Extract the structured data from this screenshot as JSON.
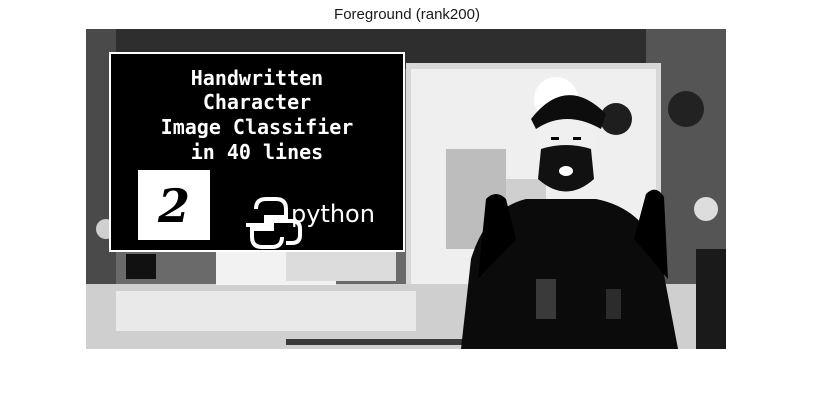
{
  "figure": {
    "title": "Foreground (rank200)"
  },
  "slide": {
    "lines": [
      "Handwritten",
      "Character",
      "Image Classifier",
      "in 40 lines"
    ],
    "digit": "2",
    "logo_word": "python",
    "logo_icon": "python-logo-icon"
  },
  "colors": {
    "background": "#ffffff",
    "slide_panel": "#000000",
    "slide_text": "#ffffff",
    "scene_dark": "#2a2a2a",
    "scene_light": "#e8e8e8"
  }
}
